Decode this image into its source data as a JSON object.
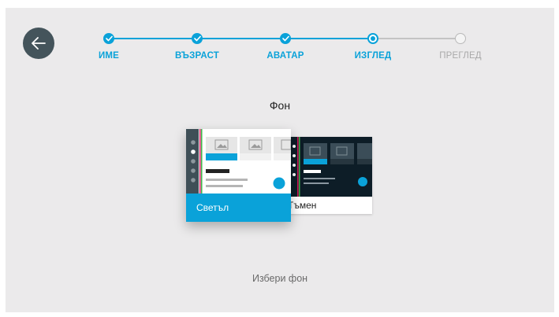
{
  "nav": {
    "back_icon": "arrow-left-icon"
  },
  "stepper": {
    "steps": [
      {
        "label": "ИМЕ",
        "state": "done"
      },
      {
        "label": "ВЪЗРАСТ",
        "state": "done"
      },
      {
        "label": "АВАТАР",
        "state": "done"
      },
      {
        "label": "ИЗГЛЕД",
        "state": "current"
      },
      {
        "label": "ПРЕГЛЕД",
        "state": "pending"
      }
    ],
    "colors": {
      "active": "#0aa2d9",
      "pending": "#b9b9b9"
    }
  },
  "main": {
    "title": "Фон",
    "hint": "Избери фон",
    "themes": [
      {
        "label": "Светъл",
        "selected": true
      },
      {
        "label": "Тъмен",
        "selected": false
      }
    ]
  },
  "colors": {
    "accent": "#0aa2d9",
    "background": "#ebeaeb",
    "back_button": "#44545b"
  }
}
